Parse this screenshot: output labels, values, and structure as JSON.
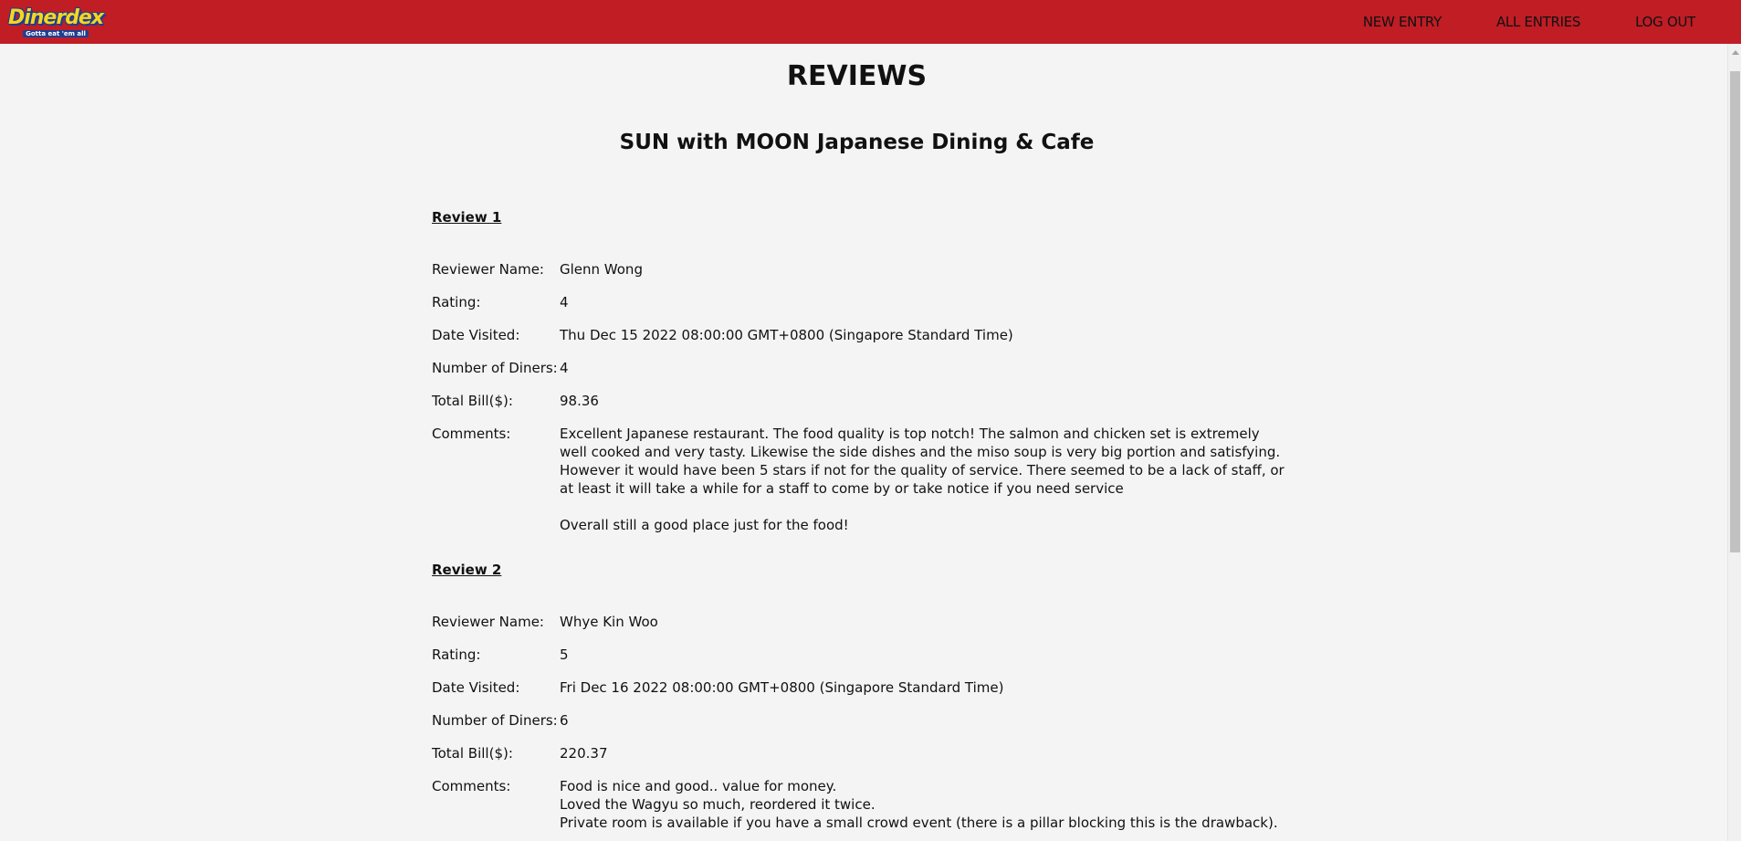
{
  "navbar": {
    "logo_title": "Dinerdex",
    "logo_tagline": "Gotta eat 'em all",
    "links": [
      "NEW ENTRY",
      "ALL ENTRIES",
      "LOG OUT"
    ]
  },
  "page": {
    "title": "REVIEWS",
    "restaurant_name": "SUN with MOON Japanese Dining & Cafe"
  },
  "labels": {
    "reviewer_name": "Reviewer Name:",
    "rating": "Rating:",
    "date_visited": "Date Visited:",
    "number_of_diners": "Number of Diners:",
    "total_bill": "Total Bill($):",
    "comments": "Comments:"
  },
  "reviews": [
    {
      "heading": "Review 1",
      "reviewer_name": "Glenn Wong",
      "rating": "4",
      "date_visited": "Thu Dec 15 2022 08:00:00 GMT+0800 (Singapore Standard Time)",
      "number_of_diners": "4",
      "total_bill": "98.36",
      "comments": "Excellent Japanese restaurant. The food quality is top notch! The salmon and chicken set is extremely well cooked and very tasty. Likewise the side dishes and the miso soup is very big portion and satisfying. However it would have been 5 stars if not for the quality of service. There seemed to be a lack of staff, or at least it will take a while for a staff to come by or take notice if you need service\n\nOverall still a good place just for the food!"
    },
    {
      "heading": "Review 2",
      "reviewer_name": "Whye Kin Woo",
      "rating": "5",
      "date_visited": "Fri Dec 16 2022 08:00:00 GMT+0800 (Singapore Standard Time)",
      "number_of_diners": "6",
      "total_bill": "220.37",
      "comments": "Food is nice and good.. value for money.\nLoved the Wagyu so much, reordered it twice.\nPrivate room is available if you have a small crowd event (there is a pillar blocking this is the drawback)."
    }
  ],
  "colors": {
    "navbar_bg": "#c01d25",
    "page_bg": "#f4f4f4",
    "logo_yellow": "#f7d51d",
    "logo_blue": "#1c3f95"
  }
}
